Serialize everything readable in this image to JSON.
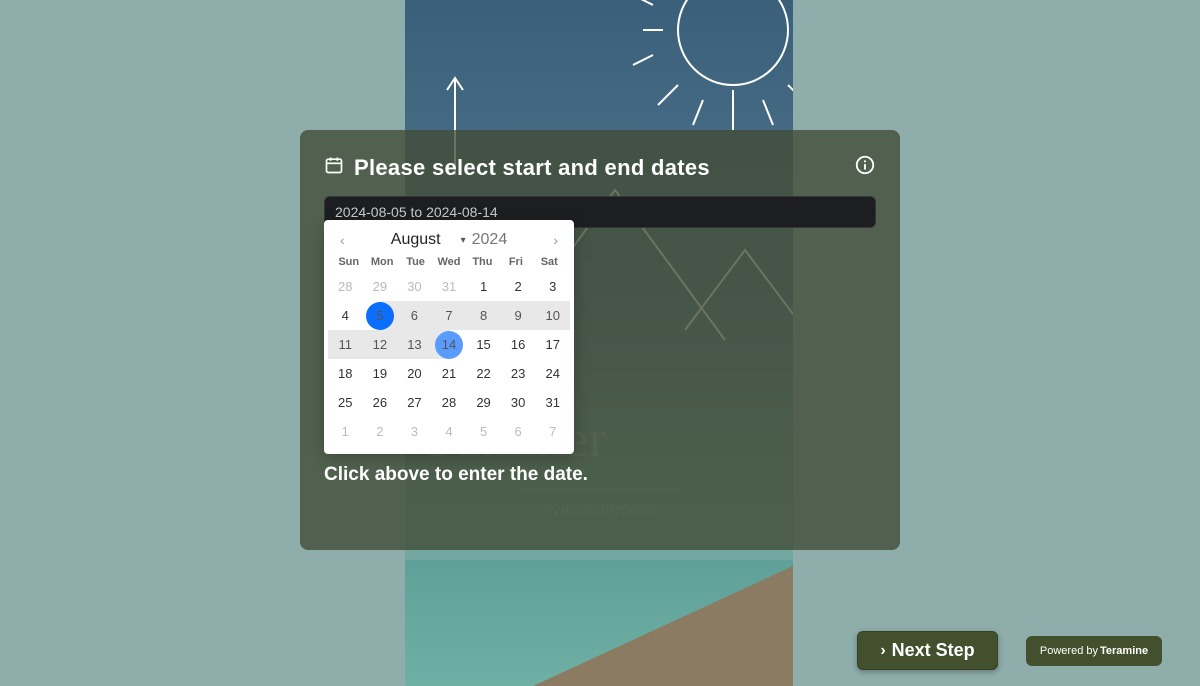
{
  "panel": {
    "title": "Please select start and end dates",
    "date_value": "2024-08-05 to 2024-08-14",
    "helper": "Click above to enter the date."
  },
  "background": {
    "big_text": "Summer",
    "hashtag": "#vacationmode"
  },
  "calendar": {
    "month": "August",
    "year": "2024",
    "dow": [
      "Sun",
      "Mon",
      "Tue",
      "Wed",
      "Thu",
      "Fri",
      "Sat"
    ],
    "weeks": [
      [
        {
          "n": "28",
          "m": true
        },
        {
          "n": "29",
          "m": true
        },
        {
          "n": "30",
          "m": true
        },
        {
          "n": "31",
          "m": true
        },
        {
          "n": "1"
        },
        {
          "n": "2"
        },
        {
          "n": "3"
        }
      ],
      [
        {
          "n": "4"
        },
        {
          "n": "5",
          "start": true,
          "r": true
        },
        {
          "n": "6",
          "r": true
        },
        {
          "n": "7",
          "r": true
        },
        {
          "n": "8",
          "r": true
        },
        {
          "n": "9",
          "r": true
        },
        {
          "n": "10",
          "r": true
        }
      ],
      [
        {
          "n": "11",
          "r": true
        },
        {
          "n": "12",
          "r": true
        },
        {
          "n": "13",
          "r": true
        },
        {
          "n": "14",
          "end": true,
          "r": true
        },
        {
          "n": "15"
        },
        {
          "n": "16"
        },
        {
          "n": "17"
        }
      ],
      [
        {
          "n": "18"
        },
        {
          "n": "19"
        },
        {
          "n": "20"
        },
        {
          "n": "21"
        },
        {
          "n": "22"
        },
        {
          "n": "23"
        },
        {
          "n": "24"
        }
      ],
      [
        {
          "n": "25"
        },
        {
          "n": "26"
        },
        {
          "n": "27"
        },
        {
          "n": "28"
        },
        {
          "n": "29"
        },
        {
          "n": "30"
        },
        {
          "n": "31"
        }
      ],
      [
        {
          "n": "1",
          "m": true
        },
        {
          "n": "2",
          "m": true
        },
        {
          "n": "3",
          "m": true
        },
        {
          "n": "4",
          "m": true
        },
        {
          "n": "5",
          "m": true
        },
        {
          "n": "6",
          "m": true
        },
        {
          "n": "7",
          "m": true
        }
      ]
    ]
  },
  "buttons": {
    "next": "Next Step",
    "powered_prefix": "Powered by",
    "powered_brand": "Teramine"
  }
}
